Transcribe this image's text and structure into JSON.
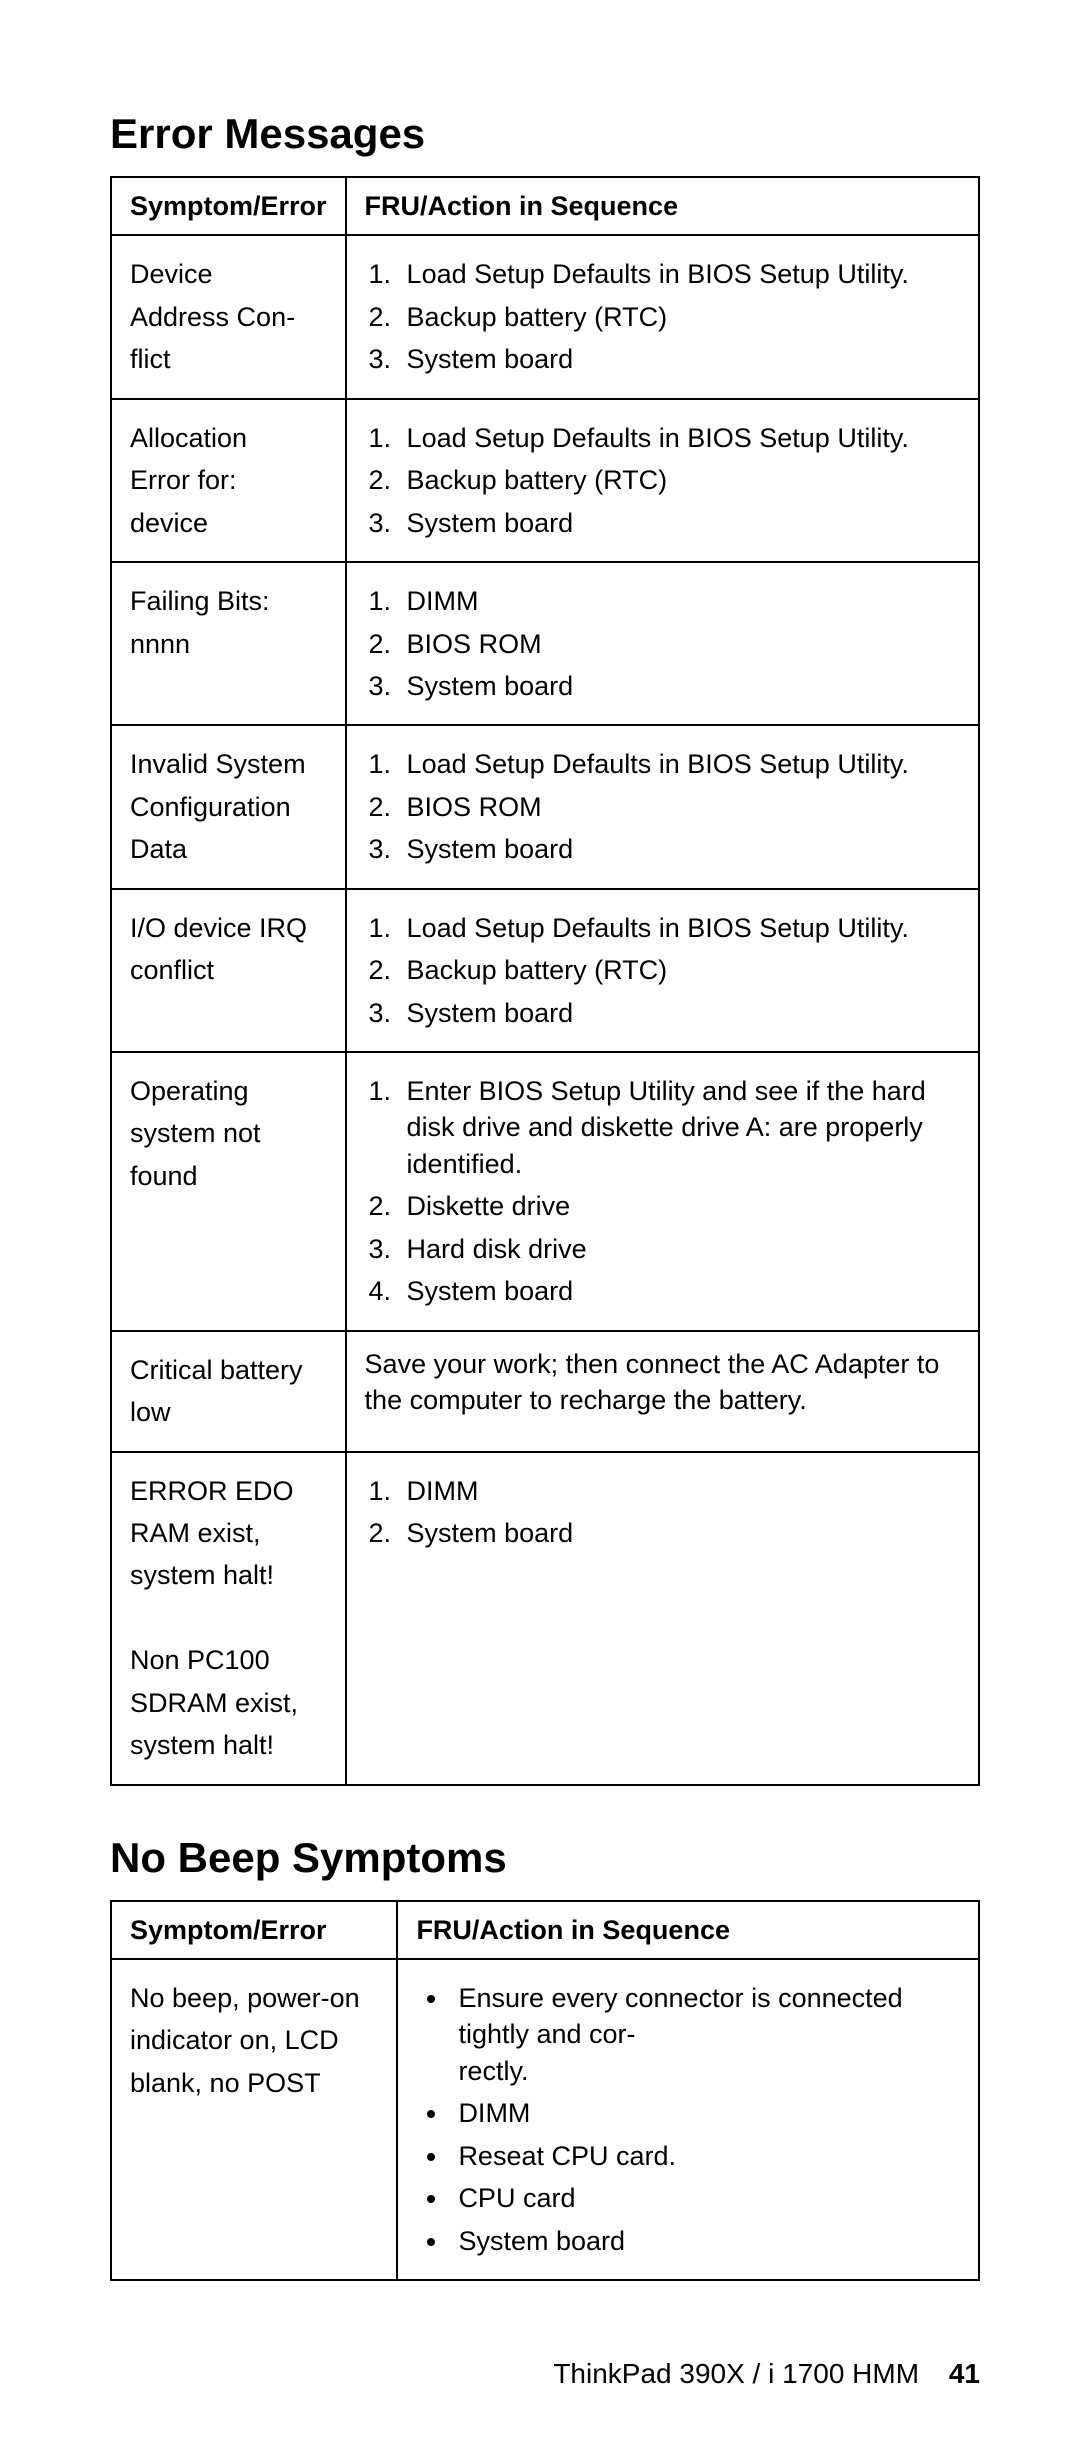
{
  "section1": {
    "title": "Error Messages",
    "head_col1": "Symptom/Error",
    "head_col2": "FRU/Action in Sequence",
    "rows": [
      {
        "symptom": "Device\nAddress Con-\nflict",
        "actions": {
          "type": "ol",
          "items": [
            "Load Setup Defaults in BIOS Setup Utility.",
            "Backup battery (RTC)",
            "System board"
          ]
        }
      },
      {
        "symptom": "Allocation\nError for:\ndevice",
        "actions": {
          "type": "ol",
          "items": [
            "Load Setup Defaults in BIOS Setup Utility.",
            "Backup battery (RTC)",
            "System board"
          ]
        }
      },
      {
        "symptom": "Failing Bits:\nnnnn",
        "actions": {
          "type": "ol",
          "items": [
            "DIMM",
            "BIOS ROM",
            "System board"
          ]
        }
      },
      {
        "symptom": "Invalid System\nConfiguration\nData",
        "actions": {
          "type": "ol",
          "items": [
            "Load Setup Defaults in BIOS Setup Utility.",
            "BIOS ROM",
            "System board"
          ]
        }
      },
      {
        "symptom": "I/O device IRQ\nconflict",
        "actions": {
          "type": "ol",
          "items": [
            "Load Setup Defaults in BIOS Setup Utility.",
            "Backup battery (RTC)",
            "System board"
          ]
        }
      },
      {
        "symptom": "Operating\nsystem not\nfound",
        "actions": {
          "type": "ol",
          "items": [
            "Enter BIOS Setup Utility and see if the hard disk drive and diskette drive A: are properly identified.",
            "Diskette drive",
            "Hard disk drive",
            "System board"
          ]
        }
      },
      {
        "symptom": "Critical battery\nlow",
        "actions": {
          "type": "text",
          "text": "Save your work; then connect the AC Adapter to the computer to recharge the battery."
        }
      },
      {
        "symptom": "ERROR EDO\nRAM exist,\nsystem halt!\n\nNon PC100\nSDRAM exist,\nsystem halt!",
        "actions": {
          "type": "ol",
          "items": [
            "DIMM",
            "System board"
          ]
        }
      }
    ]
  },
  "section2": {
    "title": "No Beep Symptoms",
    "head_col1": "Symptom/Error",
    "head_col2": "FRU/Action in Sequence",
    "rows": [
      {
        "symptom": "No beep, power-on\nindicator on, LCD\nblank, no POST",
        "actions": {
          "type": "ul",
          "items": [
            "Ensure every connector is connected tightly and cor-\nrectly.",
            "DIMM",
            "Reseat CPU card.",
            "CPU card",
            "System board"
          ]
        }
      }
    ]
  },
  "footer": {
    "model": "ThinkPad 390X / i 1700 HMM",
    "page": "41"
  }
}
